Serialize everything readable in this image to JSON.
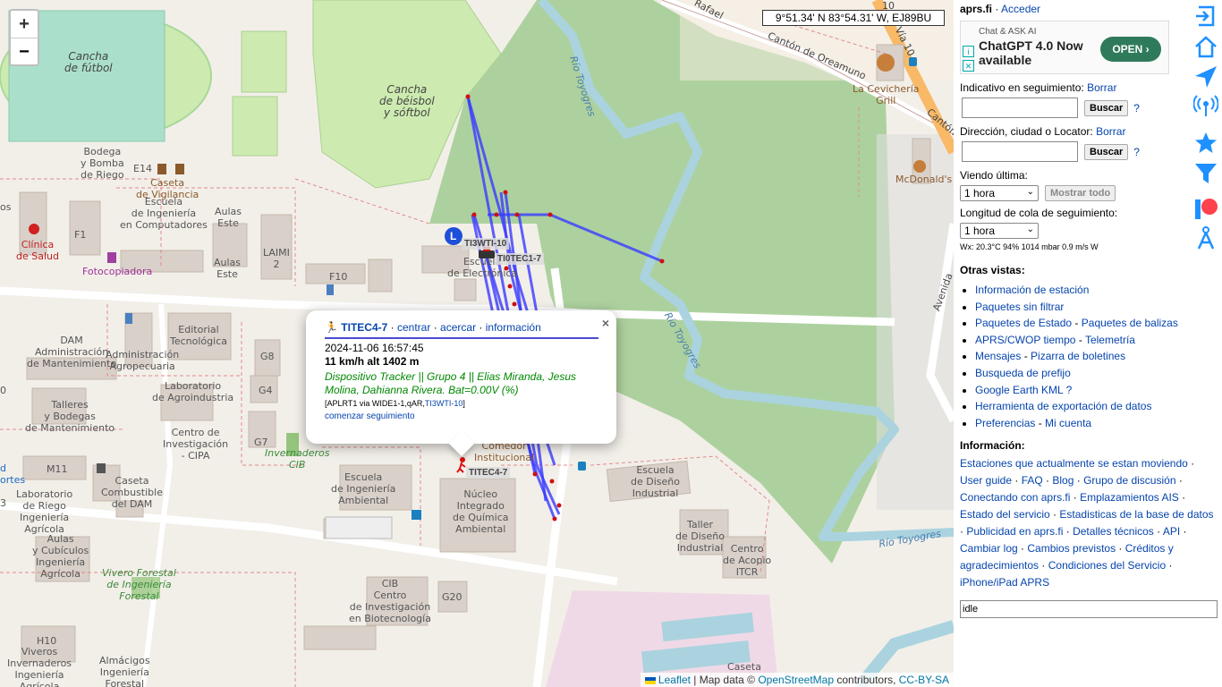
{
  "map": {
    "coords": "9°51.34' N 83°54.31' W, EJ89BU",
    "zoom_in": "+",
    "zoom_out": "−",
    "labels": {
      "cancha_futbol": "Cancha\nde fútbol",
      "cancha_beisbol": "Cancha\nde béisbol\ny sóftbol",
      "bodega": "Bodega\ny Bomba\nde Riego",
      "e14": "E14",
      "caseta_vigilancia": "Caseta\nde Vigilancia",
      "escuela_computadores": "Escuela\nde Ingeniería\nen Computadores",
      "aulas_este1": "Aulas\nEste",
      "aulas_este2": "Aulas\nEste",
      "laimi": "LAIMI\n2",
      "f1": "F1",
      "clinica": "Clínica\nde Salud",
      "fotocopiadora": "Fotocopiadora",
      "f10": "F10",
      "escuela_electronica": "Escuela\nde Electrónica",
      "dam": "DAM\nAdministración\nde Mantenimiento",
      "editorial": "Editorial\nTecnológica",
      "administracion": "Administración\nAgropecuaria",
      "g8": "G8",
      "g4": "G4",
      "g7": "G7",
      "talleres": "Talleres\ny Bodegas\nde Mantenimiento",
      "lab_agroindustria": "Laboratorio\nde Agroindustria",
      "cipa": "Centro de\nInvestigación\n- CIPA",
      "invernaderos": "Invernaderos\nCIB",
      "m11": "M11",
      "lab_riego": "Laboratorio\nde Riego\nIngeniería\nAgrícola",
      "caseta_combustible": "Caseta\nCombustible\ndel DAM",
      "escuela_ambiental": "Escuela\nde Ingeniería\nAmbiental",
      "nucleo": "Núcleo\nIntegrado\nde Química\nAmbiental",
      "comedor": "Comedor\nInstitucional",
      "escuela_diseno": "Escuela\nde Diseño\nIndustrial",
      "taller_diseno": "Taller\nde Diseño\nIndustrial",
      "centro_acopio": "Centro\nde Acopio\nITCR",
      "aulas_cubiculos": "Aulas\ny Cubículos\nIngeniería\nAgrícola",
      "vivero": "Vivero Forestal\nde Ingeniería\nForestal",
      "cib": "CIB\nCentro\nde Investigación\nen Biotecnología",
      "g20": "G20",
      "h10": "H10",
      "viveros": "Viveros\nInvernaderos\nIngeniería\nAgrícola",
      "almacigos": "Almácigos\nIngeniería\nForestal",
      "caseta_bottom": "Caseta",
      "cevicheria": "La Cevichería\nGrill",
      "mcdonalds": "McDonald's",
      "rafael": "Rafael",
      "canton_oreamuno": "Cantón de Oreamuno",
      "via10": "Vía 10",
      "v10": "10",
      "canton_c": "Cantón",
      "avenida": "Avenida",
      "rio1": "Río Toyogres",
      "rio2": "Río Toyogres",
      "rio3": "Río Toyogres",
      "left_os": "os",
      "left_0": "0",
      "left_3": "3",
      "left_ortes": "ortes",
      "left_d": "d"
    },
    "stations": {
      "ti3wti": "TI3WTI-10",
      "ti0tec": "TI0TEC1-7",
      "titec4": "TITEC4-7",
      "l_marker": "L"
    },
    "attribution": {
      "leaflet": "Leaflet",
      "mapdata": "| Map data ©",
      "osm": "OpenStreetMap",
      "contrib": "contributors,",
      "license": "CC-BY-SA"
    }
  },
  "popup": {
    "callsign": "TITEC4-7",
    "sep1": "·",
    "centrar": "centrar",
    "acercar": "acercar",
    "informacion": "información",
    "time": "2024-11-06 16:57:45",
    "speed": "11 km/h alt 1402 m",
    "comment": "Dispositivo Tracker || Grupo 4 || Elias Miranda, Jesus Molina, Dahianna Rivera. Bat=0.00V (%)",
    "path_prefix": "[APLRT1 via WIDE1-1,qAR,",
    "path_link": "TI3WTI-10",
    "path_suffix": "]",
    "track": "comenzar seguimiento",
    "close": "×"
  },
  "side": {
    "brand": "aprs.fi",
    "sep": "·",
    "login": "Acceder",
    "ad": {
      "small": "Chat & ASK AI",
      "big": "ChatGPT 4.0 Now available",
      "open": "OPEN ›",
      "i": "i",
      "x": "✕"
    },
    "indicativo_label": "Indicativo en seguimiento:",
    "borrar1": "Borrar",
    "buscar1": "Buscar",
    "q1": "?",
    "direccion_label": "Dirección, ciudad o Locator:",
    "borrar2": "Borrar",
    "buscar2": "Buscar",
    "q2": "?",
    "viendo_label": "Viendo última:",
    "viendo_value": "1 hora",
    "mostrar": "Mostrar todo",
    "cola_label": "Longitud de cola de seguimiento:",
    "cola_value": "1 hora",
    "wx": "Wx: 20.3°C 94% 1014 mbar 0.9 m/s W",
    "otras_title": "Otras vistas:",
    "otras": [
      [
        "Información de estación"
      ],
      [
        "Paquetes sin filtrar"
      ],
      [
        "Paquetes de Estado",
        "Paquetes de balizas"
      ],
      [
        "APRS/CWOP tiempo",
        "Telemetría"
      ],
      [
        "Mensajes",
        "Pizarra de boletines"
      ],
      [
        "Busqueda de prefijo"
      ],
      [
        "Google Earth KML ?"
      ],
      [
        "Herramienta de exportación de datos"
      ],
      [
        "Preferencias",
        "Mi cuenta"
      ]
    ],
    "dash": " - ",
    "info_title": "Información:",
    "info_links": [
      "Estaciones que actualmente se estan moviendo",
      "User guide",
      "FAQ",
      "Blog",
      "Grupo de discusión",
      "Conectando con aprs.fi",
      "Emplazamientos AIS",
      "Estado del servicio",
      "Estadisticas de la base de datos",
      "Publicidad en aprs.fi",
      "Detalles técnicos",
      "API",
      "Cambiar log",
      "Cambios previstos",
      "Créditos y agradecimientos",
      "Condiciones del Servicio",
      "iPhone/iPad APRS"
    ],
    "status": "idle"
  },
  "colors": {
    "track": "#3a3aff",
    "forest": "#add19e",
    "water": "#aad3df",
    "grass": "#cdebb0",
    "building": "#d9d0c9",
    "accent_blue": "#1e90ff"
  }
}
